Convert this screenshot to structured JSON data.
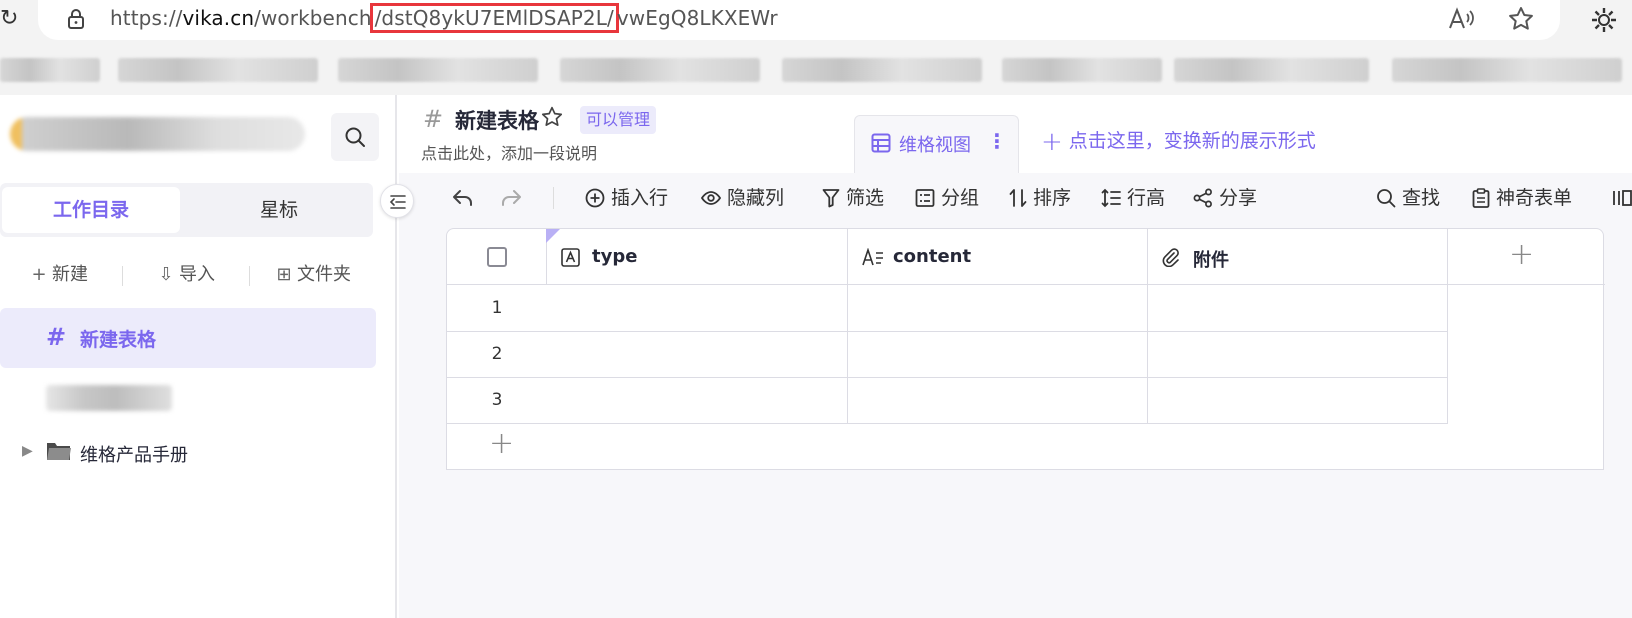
{
  "browser": {
    "url_prefix": "https://",
    "url_domain": "vika.cn",
    "url_path_1": "/workbench",
    "url_highlight": "/dstQ8ykU7EMlDSAP2L/",
    "url_path_2": "vwEgQ8LKXEWr"
  },
  "sidebar": {
    "tabs": [
      "工作目录",
      "星标"
    ],
    "actions": {
      "new": "新建",
      "import": "导入",
      "folder": "文件夹"
    },
    "nodes": {
      "active": "新建表格",
      "folder": "维格产品手册"
    }
  },
  "datasheet": {
    "title": "新建表格",
    "permission": "可以管理",
    "description_placeholder": "点击此处，添加一段说明"
  },
  "views": {
    "active_view": "维格视图",
    "add_view_hint": "点击这里，变换新的展示形式"
  },
  "toolbar": {
    "insert_row": "插入行",
    "hide_fields": "隐藏列",
    "filter": "筛选",
    "group": "分组",
    "sort": "排序",
    "row_height": "行高",
    "share": "分享",
    "search": "查找",
    "form": "神奇表单"
  },
  "grid": {
    "columns": [
      {
        "name": "type",
        "icon": "text-field-icon"
      },
      {
        "name": "content",
        "icon": "longtext-field-icon"
      },
      {
        "name": "附件",
        "icon": "attachment-field-icon"
      }
    ],
    "rows": [
      "1",
      "2",
      "3"
    ]
  },
  "colors": {
    "accent": "#7b67ee",
    "accent_light": "#ecebfb",
    "url_highlight_border": "#e8363c"
  }
}
